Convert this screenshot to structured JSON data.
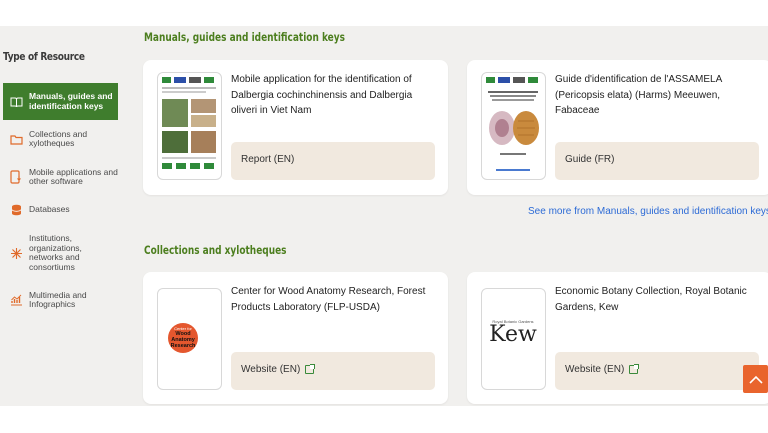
{
  "sidebar": {
    "title": "Type of Resource",
    "items": [
      {
        "label": "Manuals, guides and identification keys",
        "icon": "book-icon",
        "active": true
      },
      {
        "label": "Collections and xylotheques",
        "icon": "folder-icon",
        "active": false
      },
      {
        "label": "Mobile applications and other software",
        "icon": "mobile-download-icon",
        "active": false
      },
      {
        "label": "Databases",
        "icon": "database-icon",
        "active": false
      },
      {
        "label": "Institutions, organizations, networks and consortiums",
        "icon": "network-icon",
        "active": false
      },
      {
        "label": "Multimedia and Infographics",
        "icon": "chart-icon",
        "active": false
      }
    ]
  },
  "sections": [
    {
      "title": "Manuals, guides and identification keys",
      "cards": [
        {
          "title": "Mobile application for the identification of Dalbergia cochinchinensis and Dalbergia oliveri in Viet Nam",
          "tag": "Report (EN)",
          "external": false
        },
        {
          "title": "Guide d'identification de l'ASSAMELA (Pericopsis elata) (Harms) Meeuwen, Fabaceae",
          "tag": "Guide (FR)",
          "external": false
        }
      ],
      "see_more": "See more from Manuals, guides and identification keys"
    },
    {
      "title": "Collections and xylotheques",
      "cards": [
        {
          "title": "Center for Wood Anatomy Research, Forest Products Laboratory (FLP-USDA)",
          "tag": "Website (EN)",
          "external": true,
          "logo_text": "Wood Anatomy Research",
          "logo_small": "Center for"
        },
        {
          "title": "Economic Botany Collection, Royal Botanic Gardens, Kew",
          "tag": "Website (EN)",
          "external": true,
          "logo_text": "Kew",
          "logo_small": "Royal Botanic Gardens"
        }
      ]
    }
  ],
  "colors": {
    "accent_green": "#3f7d2d",
    "title_green": "#4c7e1e",
    "link_blue": "#2d6bd6",
    "scroll_orange": "#e9642d",
    "tag_bg": "#f1e9df"
  }
}
